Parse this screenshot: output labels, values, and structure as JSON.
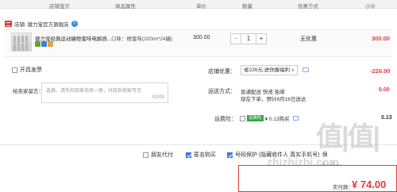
{
  "header": {
    "columns": [
      "店铺宝贝",
      "商品属性",
      "单价",
      "数量",
      "优惠方式",
      "小计"
    ]
  },
  "store": {
    "name": "店铺: 健力宝官方旗舰店",
    "badge": "?"
  },
  "item": {
    "title": "健力宝经典运动罐橙蜜味电解质...",
    "attr": "口味：橙蜜味(200ml*24罐)",
    "price": "300.00",
    "quantity": "1",
    "qty_minus": "−",
    "qty_plus": "+",
    "promo": "无优惠",
    "subtotal": "300.00",
    "tag_colors": [
      "#5aa53a",
      "#3b7ddd",
      "#e8a33a"
    ]
  },
  "invoice": {
    "label": "开具发票"
  },
  "store_coupon": {
    "label": "店铺优惠：",
    "value": "省226元:进你握福利",
    "amount": "-226.00"
  },
  "message": {
    "label": "给卖家留言：",
    "placeholder": "选填，请先和商家协商一致，付款后商家可见",
    "counter": "0/200"
  },
  "shipping": {
    "label": "运送方式：",
    "line1": "普通配送 快递 免邮",
    "line2": "现在下单，预计8月16日送达",
    "amount": "0.00"
  },
  "insurance": {
    "label": "运费险：",
    "tag": "运费险",
    "text": "¥ 0.13购买",
    "amount": "0.13"
  },
  "options": {
    "friend_pay": "朋友代付",
    "anonymous": "匿名购买",
    "privacy": "号码保护 (隐藏收件人 真实手机号)",
    "extra": "保"
  },
  "total": {
    "label": "实付款：",
    "value": "¥ 74.00"
  },
  "watermark": {
    "big": "值|值|值",
    "small": "zhizhizhi.com"
  },
  "colors": {
    "accent_red": "#e4393c",
    "check_blue": "#3b7ddd",
    "ok_green": "#3aa148"
  }
}
